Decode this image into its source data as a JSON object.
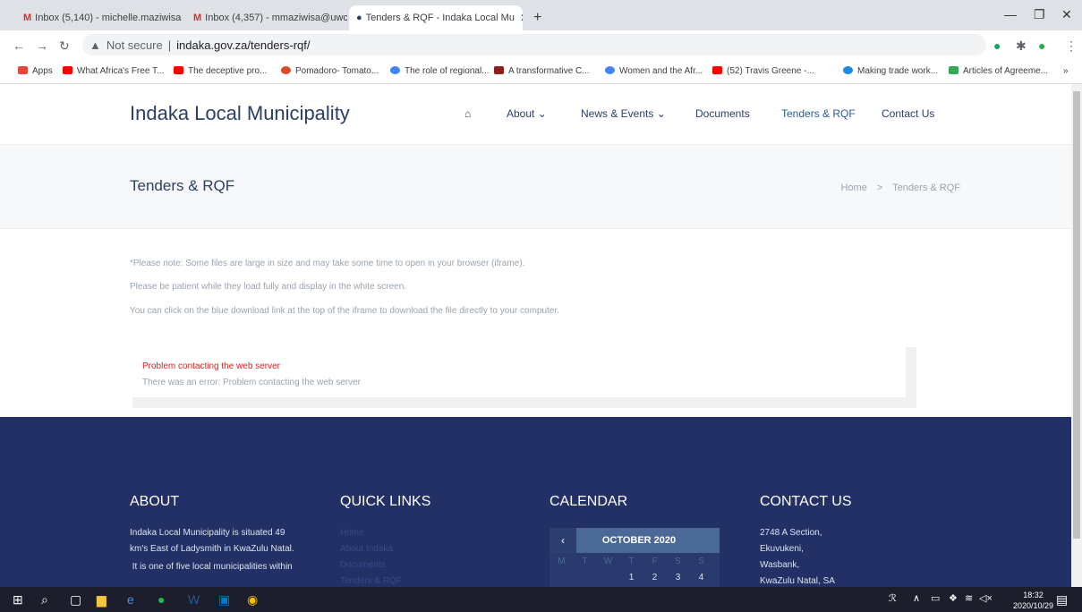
{
  "tabs": [
    {
      "label": "Inbox (5,140) - michelle.maziwisa",
      "icon": "gmail-icon"
    },
    {
      "label": "Inbox (4,357) - mmaziwisa@uwc",
      "icon": "gmail-icon"
    },
    {
      "label": "Tenders & RQF - Indaka Local Mu",
      "icon": "site-icon"
    }
  ],
  "address": {
    "not_secure": "Not secure",
    "url": "indaka.gov.za/tenders-rqf/"
  },
  "bookmarks": [
    {
      "label": "Apps",
      "color": "#e8453c"
    },
    {
      "label": "What Africa's Free T...",
      "color": "#ff0000"
    },
    {
      "label": "The deceptive pro...",
      "color": "#ff0000"
    },
    {
      "label": "Pomadoro- Tomato...",
      "color": "#d94b2b"
    },
    {
      "label": "The role of regional...",
      "color": "#4285f4"
    },
    {
      "label": "A transformative C...",
      "color": "#8e1f1f"
    },
    {
      "label": "Women and the Afr...",
      "color": "#4285f4"
    },
    {
      "label": "(52) Travis Greene -...",
      "color": "#ff0000"
    },
    {
      "label": "Making trade work...",
      "color": "#1e88e5"
    },
    {
      "label": "Articles of Agreeme...",
      "color": "#34a853"
    }
  ],
  "site": {
    "brand": "Indaka Local Municipality",
    "menu": [
      "About",
      "News & Events",
      "Documents",
      "Tenders & RQF",
      "Contact Us"
    ],
    "page_title": "Tenders & RQF",
    "breadcrumb": {
      "home": "Home",
      "sep": ">",
      "current": "Tenders & RQF"
    },
    "notes": [
      "*Please note: Some files are large in size and may take some time to open in your browser (iframe).",
      "Please be patient while they load fully and display in the white screen.",
      "You can click on the blue download link at the top of the iframe to download the file directly to your computer."
    ],
    "iframe": {
      "error_title": "Problem contacting the web server",
      "error_detail": "There was an error: Problem contacting the web server"
    }
  },
  "footer": {
    "about": {
      "heading": "ABOUT",
      "lines": [
        "Indaka Local Municipality is situated 49",
        "km's East of Ladysmith in KwaZulu Natal.",
        " It is one of five local municipalities within"
      ]
    },
    "quick_links": {
      "heading": "QUICK LINKS",
      "links": [
        "Home",
        "About Indaka",
        "Documents",
        "Tenders & RQF"
      ]
    },
    "calendar": {
      "heading": "CALENDAR",
      "month": "OCTOBER 2020",
      "prev": "‹",
      "days": [
        "M",
        "T",
        "W",
        "T",
        "F",
        "S",
        "S"
      ],
      "first_row": [
        "",
        "",
        "",
        "1",
        "2",
        "3",
        "4"
      ]
    },
    "contact": {
      "heading": "CONTACT US",
      "lines": [
        "2748 A Section,",
        "Ekuvukeni,",
        "Wasbank,",
        "KwaZulu Natal, SA"
      ]
    }
  },
  "taskbar": {
    "time": "18:32",
    "date": "2020/10/29"
  }
}
